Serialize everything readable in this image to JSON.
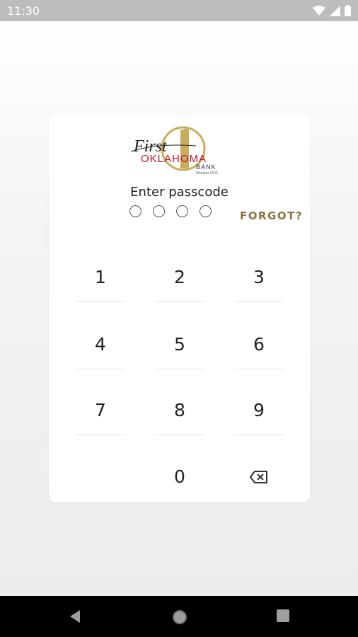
{
  "status_bar": {
    "time": "11:30"
  },
  "logo": {
    "first": "First",
    "oklahoma": "OKLAHOMA",
    "bank": "BANK",
    "member": "Member FDIC"
  },
  "passcode": {
    "prompt": "Enter passcode",
    "digits_entered": 0,
    "digits_total": 4,
    "forgot_label": "FORGOT?"
  },
  "keypad": {
    "keys": [
      "1",
      "2",
      "3",
      "4",
      "5",
      "6",
      "7",
      "8",
      "9",
      "0"
    ]
  },
  "colors": {
    "accent": "#8a7445",
    "brand_red": "#c8102e"
  }
}
